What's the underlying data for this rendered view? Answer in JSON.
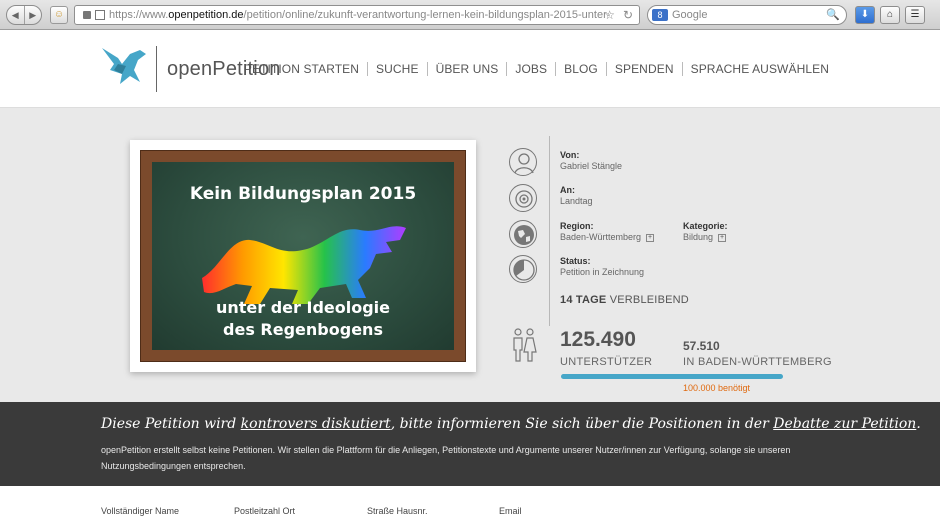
{
  "browser": {
    "url_prefix": "https://www.",
    "url_domain": "openpetition.de",
    "url_path": "/petition/online/zukunft-verantwortung-lernen-kein-bildungsplan-2015-unter-",
    "search_engine": "8",
    "search_placeholder": "Google"
  },
  "site": {
    "logo_text": "openPetition",
    "brand_color": "#46a6c8",
    "nav": [
      "PETITION STARTEN",
      "SUCHE",
      "ÜBER UNS",
      "JOBS",
      "BLOG",
      "SPENDEN",
      "SPRACHE AUSWÄHLEN"
    ]
  },
  "petition": {
    "board_title": "Kein Bildungsplan 2015",
    "board_line1": "unter der Ideologie",
    "board_line2": "des Regenbogens",
    "von_label": "Von:",
    "von_value": "Gabriel Stängle",
    "an_label": "An:",
    "an_value": "Landtag",
    "region_label": "Region:",
    "region_value": "Baden-Württemberg",
    "kategorie_label": "Kategorie:",
    "kategorie_value": "Bildung",
    "status_label": "Status:",
    "status_value": "Petition in Zeichnung",
    "days_value": "14 TAGE",
    "days_label": "VERBLEIBEND",
    "supporters_value": "125.490",
    "supporters_label": "UNTERSTÜTZER",
    "region_supporters_value": "57.510",
    "region_supporters_label": "IN BADEN-WÜRTTEMBERG",
    "goal_label": "100.000 benötigt",
    "progress_fraction": 1.0
  },
  "band": {
    "head_part1": "Diese Petition wird ",
    "head_link1": "kontrovers diskutiert",
    "head_part2": ", bitte informieren Sie sich über die Positionen in der ",
    "head_link2": "Debatte zur Petition",
    "head_part3": ".",
    "text": "openPetition erstellt selbst keine Petitionen. Wir stellen die Plattform für die Anliegen, Petitionstexte und Argumente unserer Nutzer/innen zur Verfügung, solange sie unseren Nutzungsbedingungen entsprechen."
  },
  "form": {
    "name_label": "Vollständiger Name",
    "plz_label": "Postleitzahl Ort",
    "street_label": "Straße Hausnr.",
    "email_label": "Email"
  }
}
